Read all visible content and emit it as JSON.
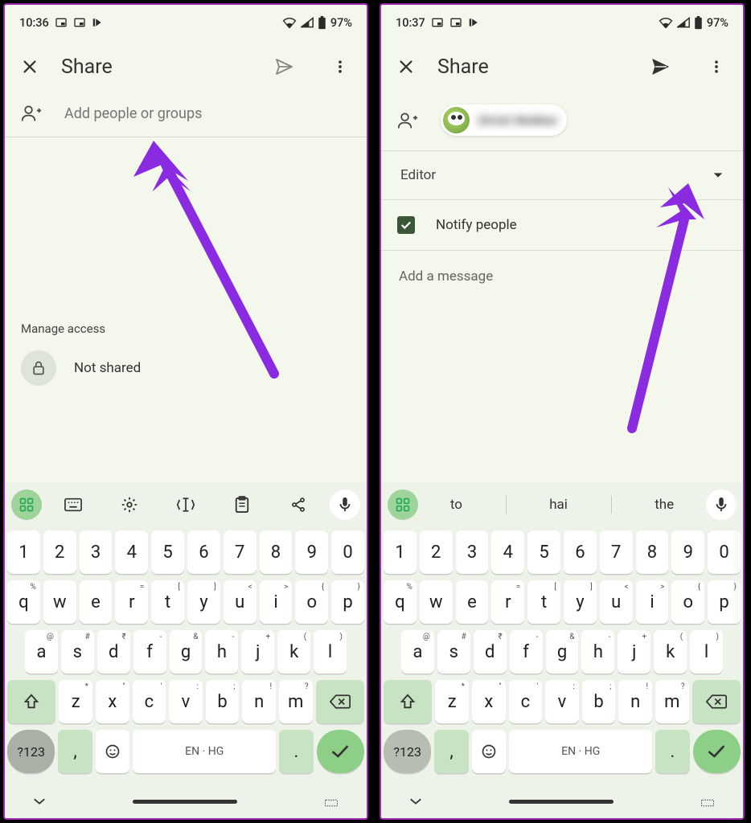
{
  "left": {
    "status": {
      "time": "10:36",
      "battery": "97%"
    },
    "header": {
      "title": "Share"
    },
    "add": {
      "placeholder": "Add people or groups"
    },
    "manage_label": "Manage access",
    "not_shared": "Not shared"
  },
  "right": {
    "status": {
      "time": "10:37",
      "battery": "97%"
    },
    "header": {
      "title": "Share"
    },
    "chip_name": "Girish Mukker",
    "role": "Editor",
    "notify_label": "Notify people",
    "message_placeholder": "Add a message"
  },
  "keyboard": {
    "row_num": [
      "1",
      "2",
      "3",
      "4",
      "5",
      "6",
      "7",
      "8",
      "9",
      "0"
    ],
    "row_q": [
      "q",
      "w",
      "e",
      "r",
      "t",
      "y",
      "u",
      "i",
      "o",
      "p"
    ],
    "row_q_sup": [
      "%",
      "",
      "",
      "=",
      "[",
      "]",
      "<",
      ">",
      "{",
      "}"
    ],
    "row_a": [
      "a",
      "s",
      "d",
      "f",
      "g",
      "h",
      "j",
      "k",
      "l"
    ],
    "row_a_sup": [
      "@",
      "#",
      "₹",
      "-",
      "&",
      "-",
      "+",
      "(",
      ")"
    ],
    "row_z": [
      "z",
      "x",
      "c",
      "v",
      "b",
      "n",
      "m"
    ],
    "row_z_sup": [
      "*",
      "\"",
      "'",
      ":",
      ";",
      "!",
      "?"
    ],
    "sym": "?123",
    "space": "EN · HG",
    "suggestions": [
      "to",
      "hai",
      "the"
    ]
  }
}
